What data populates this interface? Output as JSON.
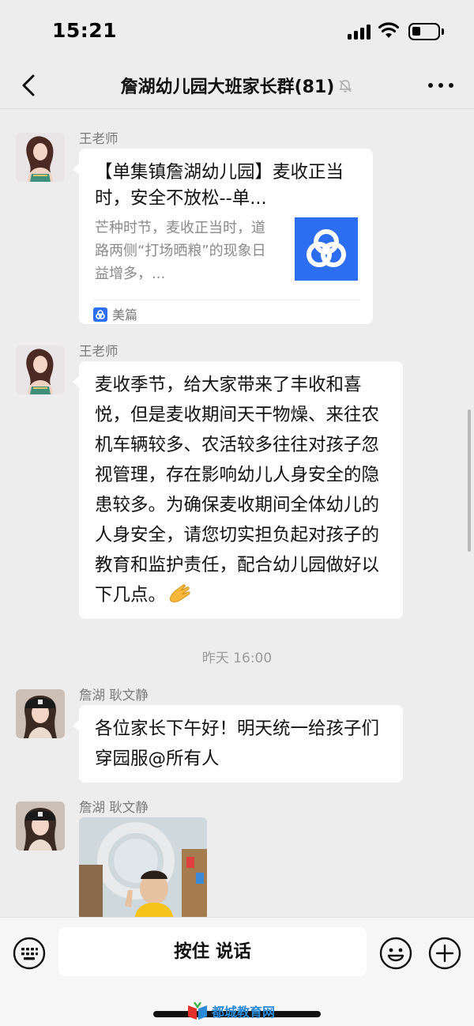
{
  "status_bar": {
    "time": "15:21"
  },
  "nav": {
    "title": "詹湖幼儿园大班家长群(81)"
  },
  "messages": [
    {
      "sender": "王老师",
      "type": "link_card",
      "card": {
        "title": "【单集镇詹湖幼儿园】麦收正当时，安全不放松--单...",
        "description": "芒种时节，麦收正当时，道路两侧“打场晒粮”的现象日益增多，...",
        "source": "美篇"
      }
    },
    {
      "sender": "王老师",
      "type": "text",
      "text": "麦收季节，给大家带来了丰收和喜悦，但是麦收期间天干物燥、来往农机车辆较多、农活较多往往对孩子忽视管理，存在影响幼儿人身安全的隐患较多。为确保麦收期间全体幼儿的人身安全，请您切实担负起对孩子的教育和监护责任，配合幼儿园做好以下几点。"
    },
    {
      "type": "timestamp",
      "text": "昨天 16:00"
    },
    {
      "sender": "詹湖  耿文静",
      "type": "text",
      "text": "各位家长下午好！明天统一给孩子们穿园服@所有人"
    },
    {
      "sender": "詹湖  耿文静",
      "type": "image"
    }
  ],
  "input_bar": {
    "hold_to_talk": "按住 说话"
  },
  "watermark": {
    "text": "都城教育网"
  },
  "colors": {
    "background": "#ededed",
    "bubble": "#ffffff",
    "meipian_blue": "#2c6df2"
  },
  "icons": [
    "back-icon",
    "mute-icon",
    "more-icon",
    "keyboard-icon",
    "emoji-icon",
    "plus-icon",
    "meipian-icon"
  ]
}
